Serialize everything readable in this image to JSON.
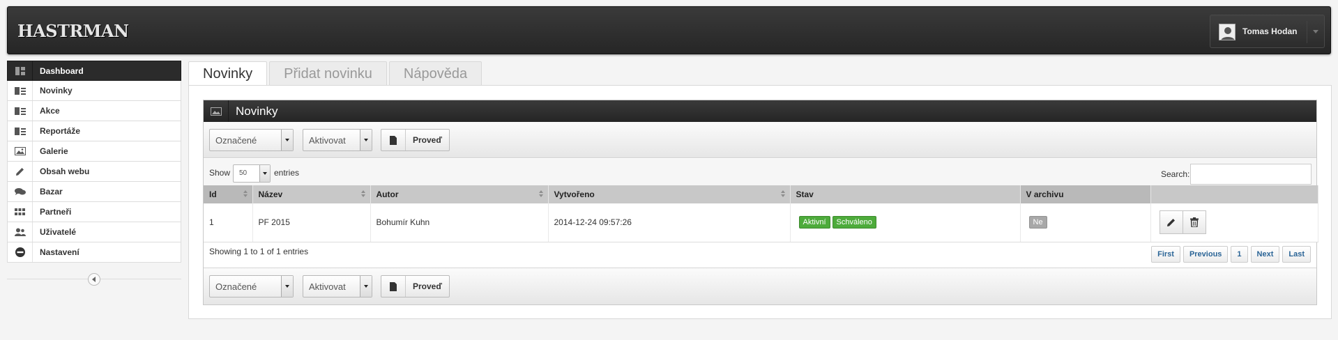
{
  "header": {
    "logo": "HASTRMAN",
    "user_name": "Tomas Hodan"
  },
  "sidebar": {
    "items": [
      {
        "label": "Dashboard",
        "icon": "dashboard-icon",
        "active": true
      },
      {
        "label": "Novinky",
        "icon": "newspaper-icon"
      },
      {
        "label": "Akce",
        "icon": "newspaper-icon"
      },
      {
        "label": "Reportáže",
        "icon": "newspaper-icon"
      },
      {
        "label": "Galerie",
        "icon": "image-icon"
      },
      {
        "label": "Obsah webu",
        "icon": "pencil-icon"
      },
      {
        "label": "Bazar",
        "icon": "comments-icon"
      },
      {
        "label": "Partneři",
        "icon": "grid-icon"
      },
      {
        "label": "Uživatelé",
        "icon": "users-icon"
      },
      {
        "label": "Nastavení",
        "icon": "minus-circle-icon"
      }
    ]
  },
  "tabs": [
    {
      "label": "Novinky",
      "active": true
    },
    {
      "label": "Přidat novinku"
    },
    {
      "label": "Nápověda"
    }
  ],
  "widget": {
    "title": "Novinky"
  },
  "toolbar": {
    "selection": "Označené",
    "action": "Aktivovat",
    "submit": "Proveď"
  },
  "filter": {
    "show": "Show",
    "length": "50",
    "entries": "entries",
    "search": "Search:"
  },
  "table": {
    "columns": [
      "Id",
      "Název",
      "Autor",
      "Vytvořeno",
      "Stav",
      "V archivu",
      ""
    ],
    "rows": [
      {
        "id": "1",
        "nazev": "PF 2015",
        "autor": "Bohumír Kuhn",
        "vytvoreno": "2014-12-24 09:57:26",
        "stav": [
          "Aktivní",
          "Schváleno"
        ],
        "archiv": "Ne"
      }
    ]
  },
  "info": "Showing 1 to 1 of 1 entries",
  "pagination": [
    "First",
    "Previous",
    "1",
    "Next",
    "Last"
  ],
  "colors": {
    "header_bg": "#2b2b2b",
    "badge_green": "#4dab3b",
    "badge_gray": "#a8a8a8",
    "link": "#2a6496"
  }
}
